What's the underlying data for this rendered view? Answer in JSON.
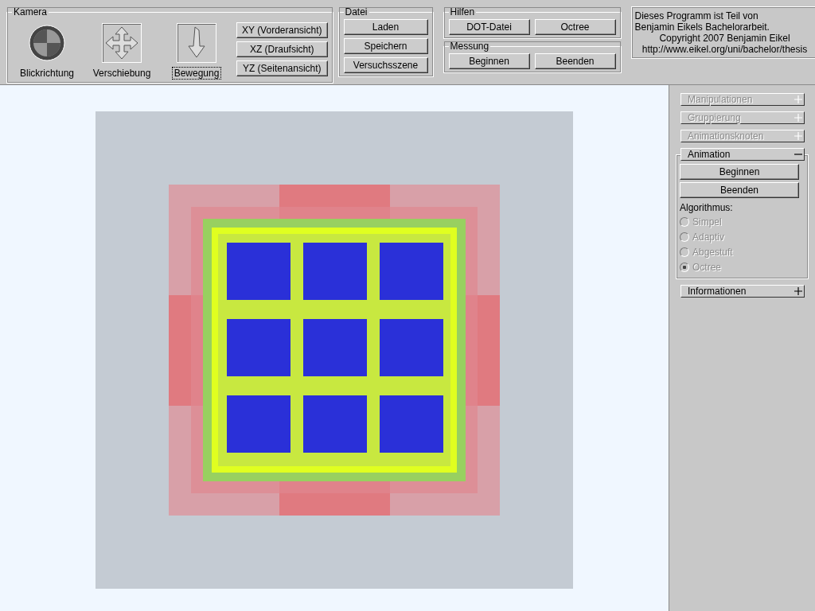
{
  "camera": {
    "title": "Kamera",
    "tools": [
      {
        "label": "Blickrichtung",
        "kind": "sphere",
        "selected": false
      },
      {
        "label": "Verschiebung",
        "kind": "move",
        "selected": false
      },
      {
        "label": "Bewegung",
        "kind": "arrow",
        "selected": true
      }
    ],
    "views": [
      "XY (Vorderansicht)",
      "XZ (Draufsicht)",
      "YZ (Seitenansicht)"
    ]
  },
  "file": {
    "title": "Datei",
    "buttons": [
      "Laden",
      "Speichern",
      "Versuchsszene"
    ]
  },
  "helpers": {
    "title": "Hilfen",
    "buttons": [
      "DOT-Datei",
      "Octree"
    ]
  },
  "measurement": {
    "title": "Messung",
    "buttons": [
      "Beginnen",
      "Beenden"
    ]
  },
  "info": [
    "Dieses Programm ist Teil von",
    "Benjamin Eikels Bachelorarbeit.",
    "Copyright 2007 Benjamin Eikel",
    "http://www.eikel.org/uni/bachelor/thesis"
  ],
  "sections": [
    {
      "title": "Manipulationen",
      "expanded": false,
      "disabled": true
    },
    {
      "title": "Gruppierung",
      "expanded": false,
      "disabled": true
    },
    {
      "title": "Animationsknoten",
      "expanded": false,
      "disabled": true
    },
    {
      "title": "Animation",
      "expanded": true,
      "disabled": false,
      "buttons": [
        "Beginnen",
        "Beenden"
      ],
      "label": "Algorithmus:",
      "options": [
        {
          "label": "Simpel",
          "selected": false,
          "disabled": true
        },
        {
          "label": "Adaptiv",
          "selected": false,
          "disabled": true
        },
        {
          "label": "Abgestuft",
          "selected": false,
          "disabled": true
        },
        {
          "label": "Octree",
          "selected": true,
          "disabled": true
        }
      ]
    },
    {
      "title": "Informationen",
      "expanded": false,
      "disabled": false
    }
  ]
}
